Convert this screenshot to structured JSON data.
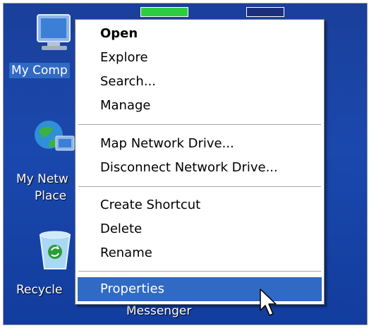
{
  "desktop": {
    "icons": [
      {
        "name": "my-computer",
        "label": "My Comp",
        "icon": "computer-icon"
      },
      {
        "name": "my-network-places",
        "label_line1": "My Netw",
        "label_line2": "Place",
        "icon": "network-globe-icon"
      },
      {
        "name": "recycle-bin",
        "label": "Recycle",
        "icon": "recycle-bin-icon"
      },
      {
        "name": "messenger",
        "label": "Messenger",
        "icon": "messenger-icon"
      }
    ]
  },
  "context_menu": {
    "items": [
      {
        "label": "Open",
        "bold": true
      },
      {
        "label": "Explore"
      },
      {
        "label": "Search..."
      },
      {
        "label": "Manage"
      },
      {
        "label": "Map Network Drive..."
      },
      {
        "label": "Disconnect Network Drive..."
      },
      {
        "label": "Create Shortcut"
      },
      {
        "label": "Delete"
      },
      {
        "label": "Rename"
      },
      {
        "label": "Properties",
        "highlighted": true
      }
    ]
  },
  "colors": {
    "desktop": "#1b48ad",
    "highlight": "#316ac5",
    "menu_bg": "#ffffff"
  }
}
